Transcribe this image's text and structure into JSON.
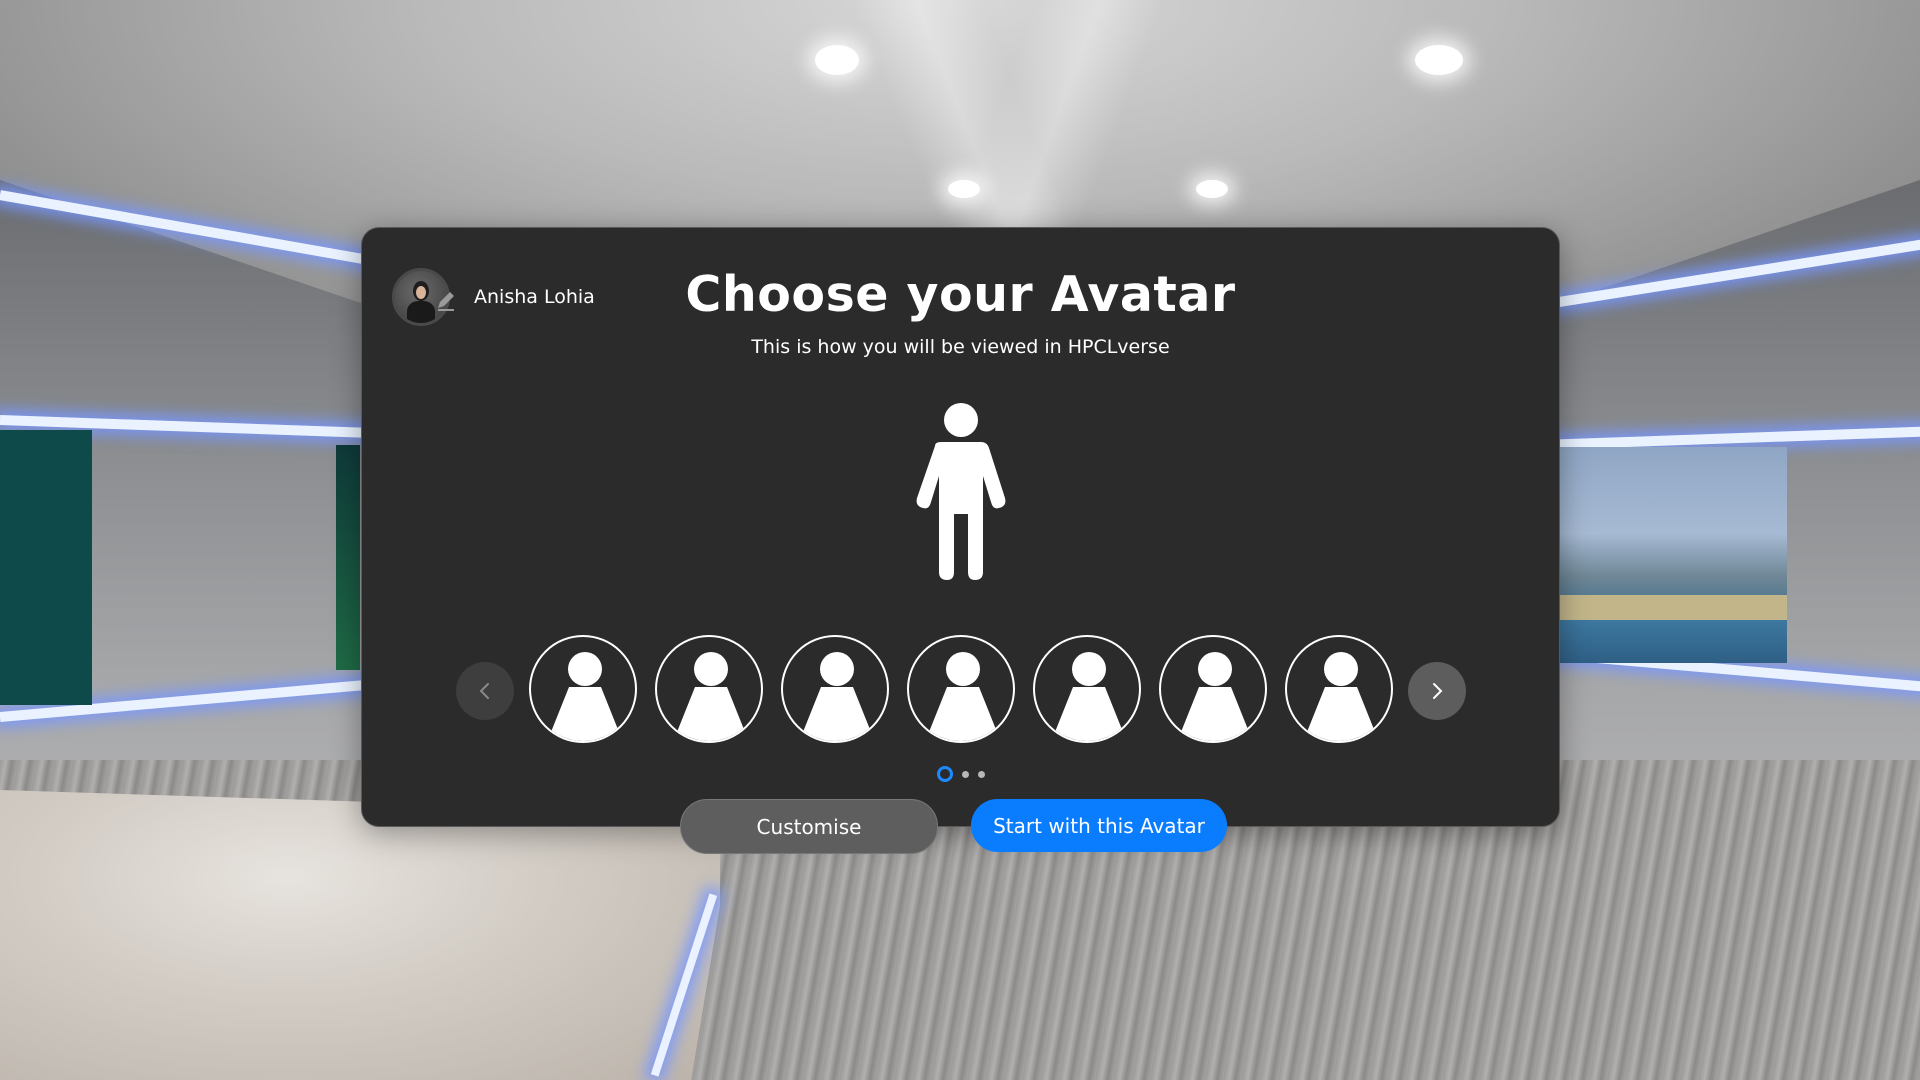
{
  "user": {
    "name": "Anisha Lohia",
    "avatar_icon": "user-photo-icon",
    "edit_icon": "pencil-icon"
  },
  "dialog": {
    "title": "Choose your Avatar",
    "subtitle": "This is how you will be viewed in HPCLverse"
  },
  "carousel": {
    "prev_icon": "chevron-left-icon",
    "next_icon": "chevron-right-icon",
    "option_count": 7,
    "pages": 3,
    "active_page": 1
  },
  "actions": {
    "customise_label": "Customise",
    "start_label": "Start with this Avatar"
  },
  "colors": {
    "dialog_bg": "#2b2b2b",
    "primary": "#0a7dff",
    "secondary_button": "#5e5e5e",
    "active_dot": "#1e88ff"
  }
}
